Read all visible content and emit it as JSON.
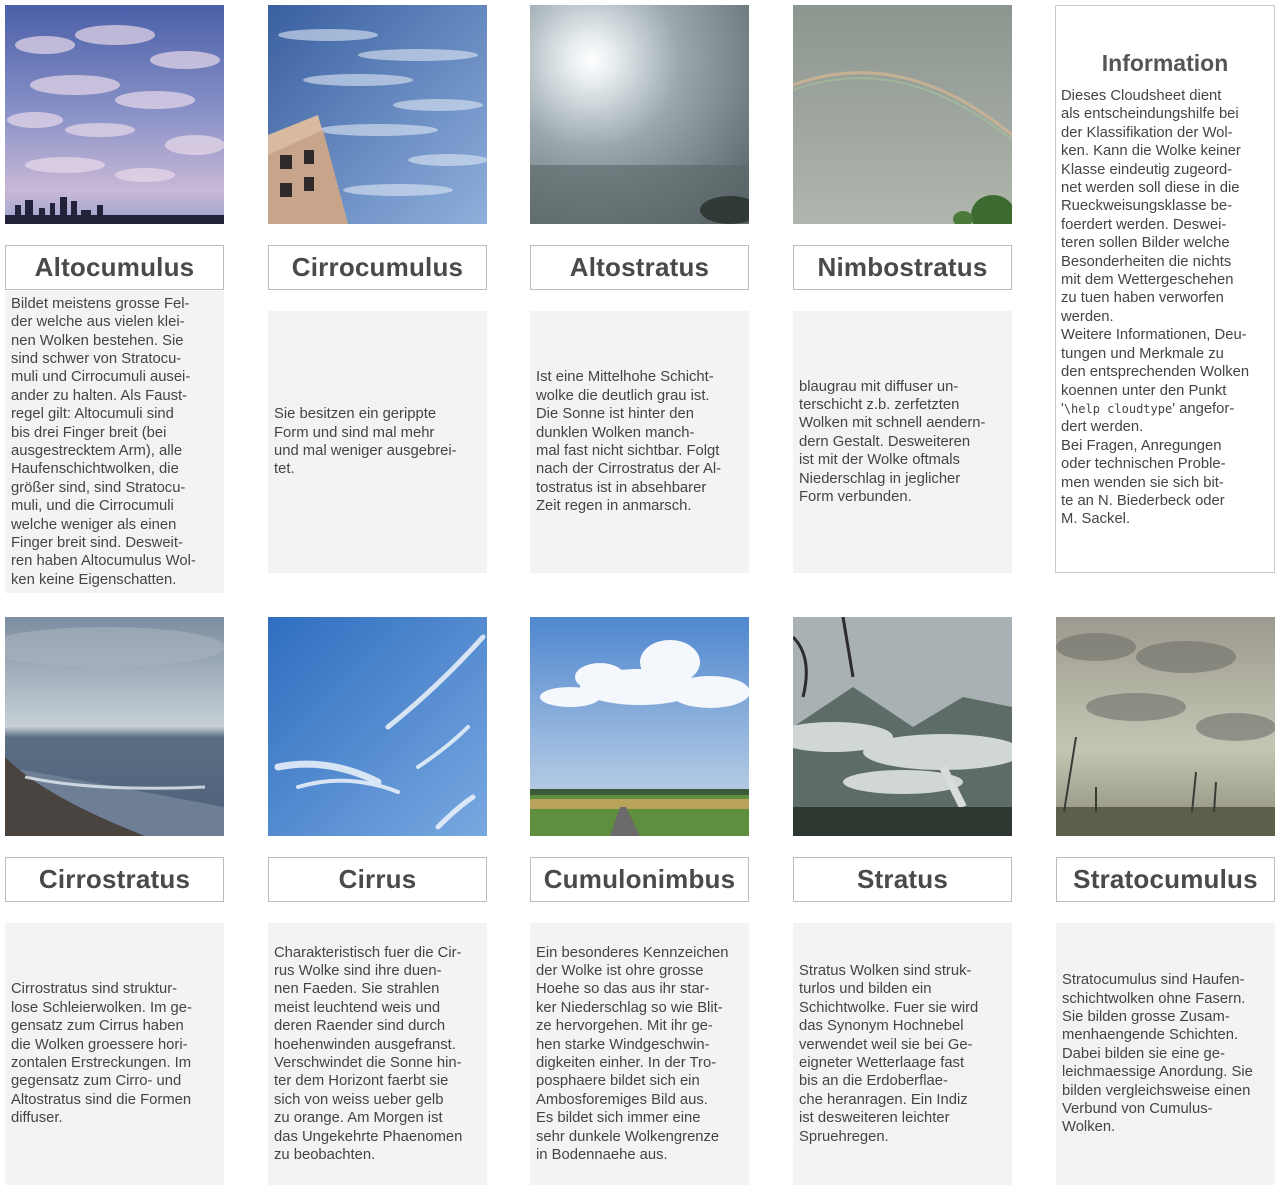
{
  "info": {
    "title": "Information",
    "text_part1": "Dieses Cloudsheet dient\nals entscheindungshilfe bei\nder Klassifikation der Wol-\nken. Kann die Wolke keiner\nKlasse eindeutig zugeord-\nnet werden soll diese in die\nRueckweisungsklasse be-\nfoerdert werden. Deswei-\nteren sollen Bilder welche\nBesonderheiten die nichts\nmit dem Wettergeschehen\nzu tuen haben verworfen\nwerden.\nWeitere Informationen, Deu-\ntungen und Merkmale zu\nden entsprechenden Wolken\nkoennen unter den Punkt\n'",
    "text_code": "\\help cloudtype",
    "text_part2": "' angefor-\ndert werden.\nBei Fragen, Anregungen\noder technischen Proble-\nmen wenden sie sich bit-\nte an N. Biederbeck oder\nM. Sackel."
  },
  "clouds": [
    {
      "name": "Altocumulus",
      "description": "Bildet meistens grosse Fel-\nder welche aus vielen klei-\nnen Wolken bestehen. Sie\nsind schwer von Stratocu-\nmuli und Cirrocumuli ausei-\nander zu halten. Als Faust-\nregel gilt: Altocumuli sind\nbis drei Finger breit (bei\nausgestrecktem Arm), alle\nHaufenschichtwolken, die\ngrößer sind, sind Stratocu-\nmuli, und die Cirrocumuli\nwelche weniger als einen\nFinger breit sind. Desweit-\nren haben Altocumulus Wol-\nken keine Eigenschatten."
    },
    {
      "name": "Cirrocumulus",
      "description": "Sie besitzen ein gerippte\nForm und sind mal mehr\nund mal weniger ausgebrei-\ntet."
    },
    {
      "name": "Altostratus",
      "description": "Ist eine Mittelhohe Schicht-\nwolke die deutlich grau ist.\nDie Sonne ist hinter den\ndunklen Wolken manch-\nmal fast nicht sichtbar. Folgt\nnach der Cirrostratus der Al-\ntostratus ist in absehbarer\nZeit regen in anmarsch."
    },
    {
      "name": "Nimbostratus",
      "description": "blaugrau mit diffuser un-\nterschicht z.b. zerfetzten\nWolken mit schnell aendern-\ndern Gestalt. Desweiteren\nist mit der Wolke oftmals\nNiederschlag in jeglicher\nForm verbunden."
    },
    {
      "name": "Cirrostratus",
      "description": "Cirrostratus sind struktur-\nlose Schleierwolken. Im ge-\ngensatz zum Cirrus haben\ndie Wolken groessere hori-\nzontalen Erstreckungen. Im\ngegensatz zum Cirro- und\nAltostratus sind die Formen\ndiffuser."
    },
    {
      "name": "Cirrus",
      "description": "Charakteristisch fuer die Cir-\nrus Wolke sind ihre duen-\nnen Faeden. Sie strahlen\nmeist leuchtend weis und\nderen Raender sind durch\nhoehenwinden ausgefranst.\nVerschwindet die Sonne hin-\nter dem Horizont faerbt sie\nsich von weiss ueber gelb\nzu orange. Am Morgen ist\ndas Ungekehrte Phaenomen\nzu beobachten."
    },
    {
      "name": "Cumulonimbus",
      "description": "Ein besonderes Kennzeichen\nder Wolke ist ohre grosse\nHoehe so das aus ihr star-\nker Niederschlag so wie Blit-\nze hervorgehen. Mit ihr ge-\nhen starke Windgeschwin-\ndigkeiten einher. In der Tro-\nposphaere bildet sich ein\nAmbosforemiges Bild aus.\nEs bildet sich immer eine\nsehr dunkele Wolkengrenze\nin Bodennaehe aus."
    },
    {
      "name": "Stratus",
      "description": "Stratus Wolken sind struk-\nturlos und bilden ein\nSchichtwolke. Fuer sie wird\ndas Synonym Hochnebel\nverwendet weil sie bei Ge-\neigneter Wetterlaage fast\nbis an die Erdoberflae-\nche heranragen. Ein Indiz\nist desweiteren leichter\nSpruehregen."
    },
    {
      "name": "Stratocumulus",
      "description": "Stratocumulus sind Haufen-\nschichtwolken ohne Fasern.\nSie bilden grosse Zusam-\nmenhaengende Schichten.\nDabei bilden sie eine ge-\nleichmaessige Anordung. Sie\nbilden vergleichsweise einen\nVerbund von Cumulus-\nWolken."
    }
  ]
}
